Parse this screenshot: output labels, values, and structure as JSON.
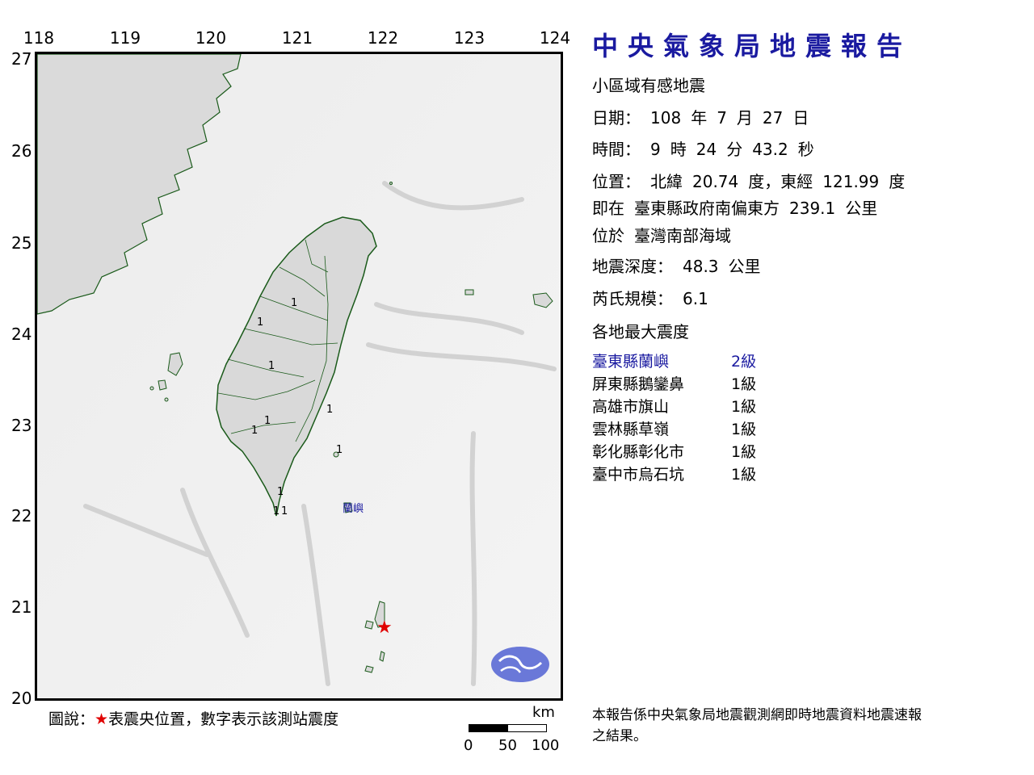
{
  "map": {
    "lon_ticks": [
      "118",
      "119",
      "120",
      "121",
      "122",
      "123",
      "124"
    ],
    "lat_ticks": [
      "27",
      "26",
      "25",
      "24",
      "23",
      "22",
      "21",
      "20"
    ],
    "epicenter_label": "★",
    "station_place_label": "蘭嶼",
    "intensity_markers": [
      "1",
      "1",
      "1",
      "1",
      "1",
      "1",
      "1",
      "1",
      "1",
      "1"
    ],
    "legend": {
      "prefix": "圖說：",
      "star": "★",
      "text": "表震央位置，數字表示該測站震度"
    },
    "scale": {
      "unit": "km",
      "ticks": [
        "0",
        "50",
        "100"
      ]
    },
    "colors": {
      "epicenter": "#e00000",
      "coast": "#1a5a1a",
      "label": "#1a1aa0",
      "logo": "#6a78d8"
    }
  },
  "report": {
    "title": "中央氣象局地震報告",
    "type": "小區域有感地震",
    "date": {
      "label": "日期：",
      "year": "108",
      "year_unit": "年",
      "month": "7",
      "month_unit": "月",
      "day": "27",
      "day_unit": "日"
    },
    "time": {
      "label": "時間：",
      "hour": "9",
      "hour_unit": "時",
      "minute": "24",
      "minute_unit": "分",
      "second": "43.2",
      "second_unit": "秒"
    },
    "position": {
      "label": "位置：",
      "lat_prefix": "北緯",
      "lat": "20.74",
      "lat_unit": "度，東經",
      "lon": "121.99",
      "lon_unit": "度"
    },
    "relative": {
      "label": "即在",
      "ref": "臺東縣政府南偏東方",
      "distance": "239.1",
      "distance_unit": "公里"
    },
    "region": {
      "label": "位於",
      "name": "臺灣南部海域"
    },
    "depth": {
      "label": "地震深度：",
      "value": "48.3",
      "unit": "公里"
    },
    "magnitude": {
      "label": "芮氏規模：",
      "value": "6.1"
    },
    "intensity_heading": "各地最大震度",
    "stations": [
      {
        "name": "臺東縣蘭嶼",
        "level": "2級"
      },
      {
        "name": "屏東縣鵝鑾鼻",
        "level": "1級"
      },
      {
        "name": "高雄市旗山",
        "level": "1級"
      },
      {
        "name": "雲林縣草嶺",
        "level": "1級"
      },
      {
        "name": "彰化縣彰化市",
        "level": "1級"
      },
      {
        "name": "臺中市烏石坑",
        "level": "1級"
      }
    ],
    "footnote": "本報告係中央氣象局地震觀測網即時地震資料地震速報之結果。"
  }
}
